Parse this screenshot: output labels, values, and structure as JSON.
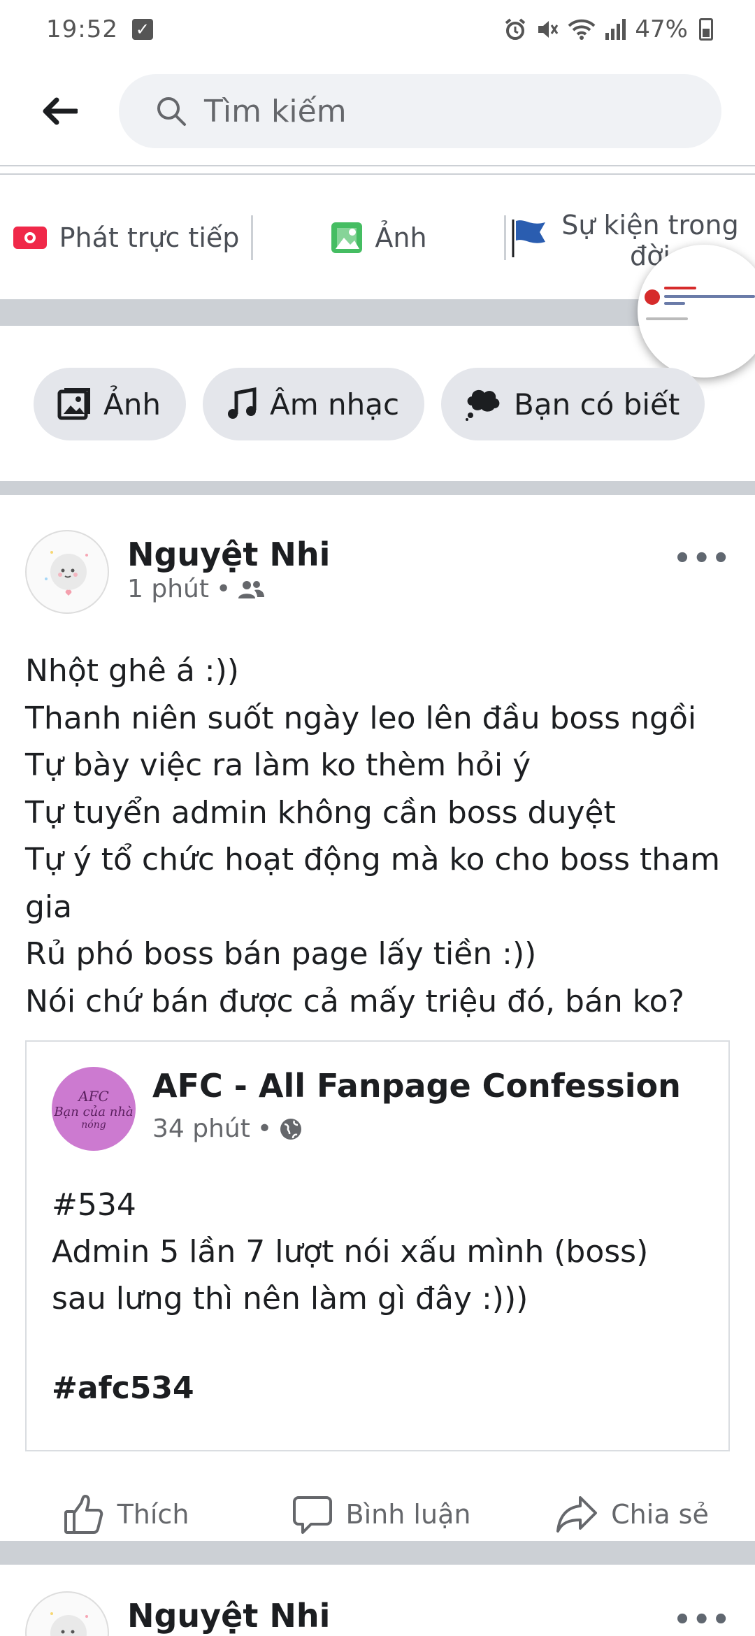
{
  "status_bar": {
    "time": "19:52",
    "battery": "47%"
  },
  "search": {
    "placeholder": "Tìm kiếm"
  },
  "composer": {
    "live_label": "Phát trực tiếp",
    "photo_label": "Ảnh",
    "event_label": "Sự kiện trong đời"
  },
  "chips": [
    {
      "label": "Ảnh",
      "icon": "photo-icon"
    },
    {
      "label": "Âm nhạc",
      "icon": "music-note-icon"
    },
    {
      "label": "Bạn có biết",
      "icon": "thought-bubble-icon"
    }
  ],
  "post": {
    "author": "Nguyệt Nhi",
    "time": "1 phút",
    "privacy_icon": "friends-icon",
    "text": "Nhột ghê á :))\nThanh niên suốt ngày leo lên đầu boss ngồi\nTự bày việc ra làm ko thèm hỏi ý\nTự tuyển admin không cần boss duyệt\nTự ý tổ chức hoạt động mà ko cho boss tham gia\nRủ phó boss bán page lấy tiền :))\nNói chứ bán được cả mấy triệu đó, bán ko?",
    "shared": {
      "page_name": "AFC - All Fanpage Confession",
      "time": "34 phút",
      "privacy_icon": "globe-icon",
      "avatar_text": [
        "AFC",
        "Bạn của nhà",
        "nóng"
      ],
      "text": "#534\nAdmin 5 lần 7 lượt nói xấu mình (boss)\nsau lưng thì nên làm gì đây :)))",
      "tag": "#afc534"
    },
    "actions": {
      "like": "Thích",
      "comment": "Bình luận",
      "share": "Chia sẻ"
    }
  },
  "next_post": {
    "author": "Nguyệt Nhi"
  },
  "colors": {
    "live_red": "#f02849",
    "photo_green": "#45bd62",
    "flag_blue": "#2a5db0",
    "divider_gray": "#ccd0d5",
    "chip_bg": "#e4e6eb"
  }
}
